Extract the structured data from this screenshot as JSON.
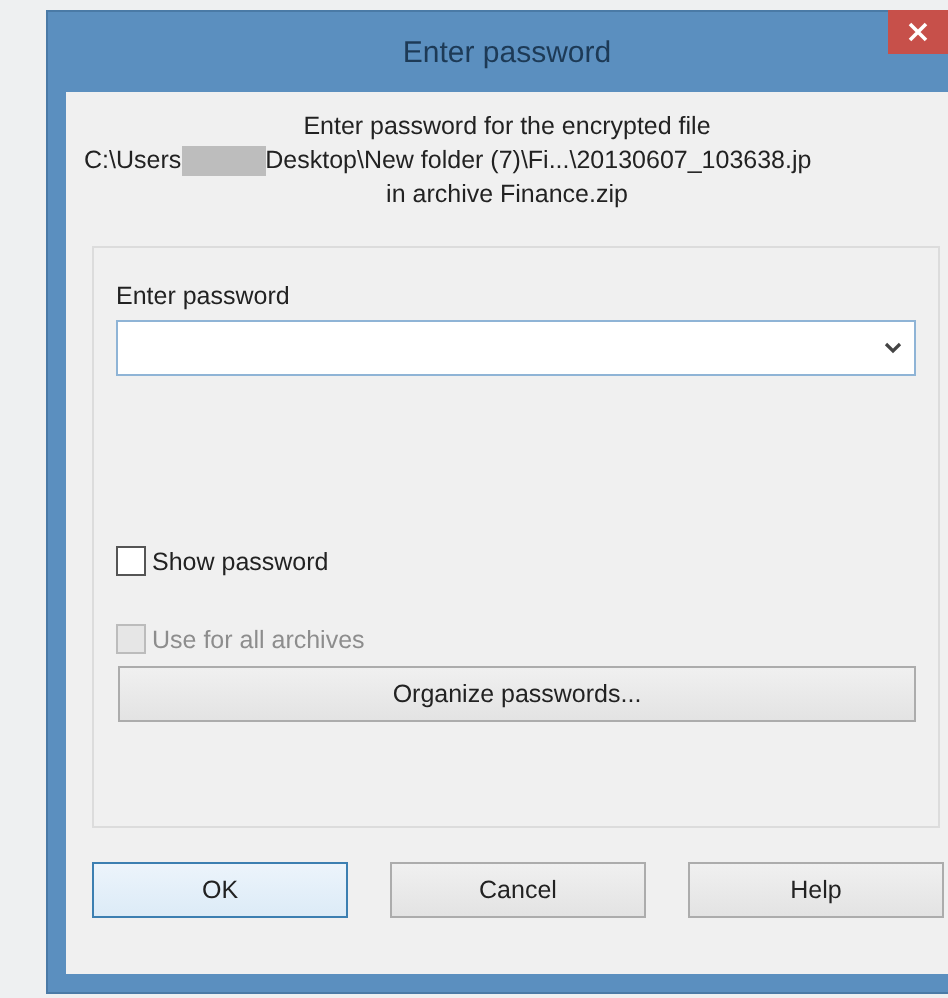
{
  "window": {
    "title": "Enter password"
  },
  "message": {
    "line_1": "Enter password for the encrypted file",
    "path_start": "C:\\Users",
    "path_end": "Desktop\\New folder (7)\\Fi...\\20130607_103638.jp",
    "line_3": "in archive Finance.zip"
  },
  "password": {
    "label": "Enter password"
  },
  "checkboxes": [
    {
      "label": "Show password",
      "checked": false,
      "disabled": false
    },
    {
      "label": "Use for all archives",
      "checked": false,
      "disabled": true
    }
  ],
  "organize_button": "Organize passwords...",
  "buttons": [
    {
      "label": "OK",
      "default": true
    },
    {
      "label": "Cancel",
      "default": false
    },
    {
      "label": "Help",
      "default": false
    }
  ]
}
